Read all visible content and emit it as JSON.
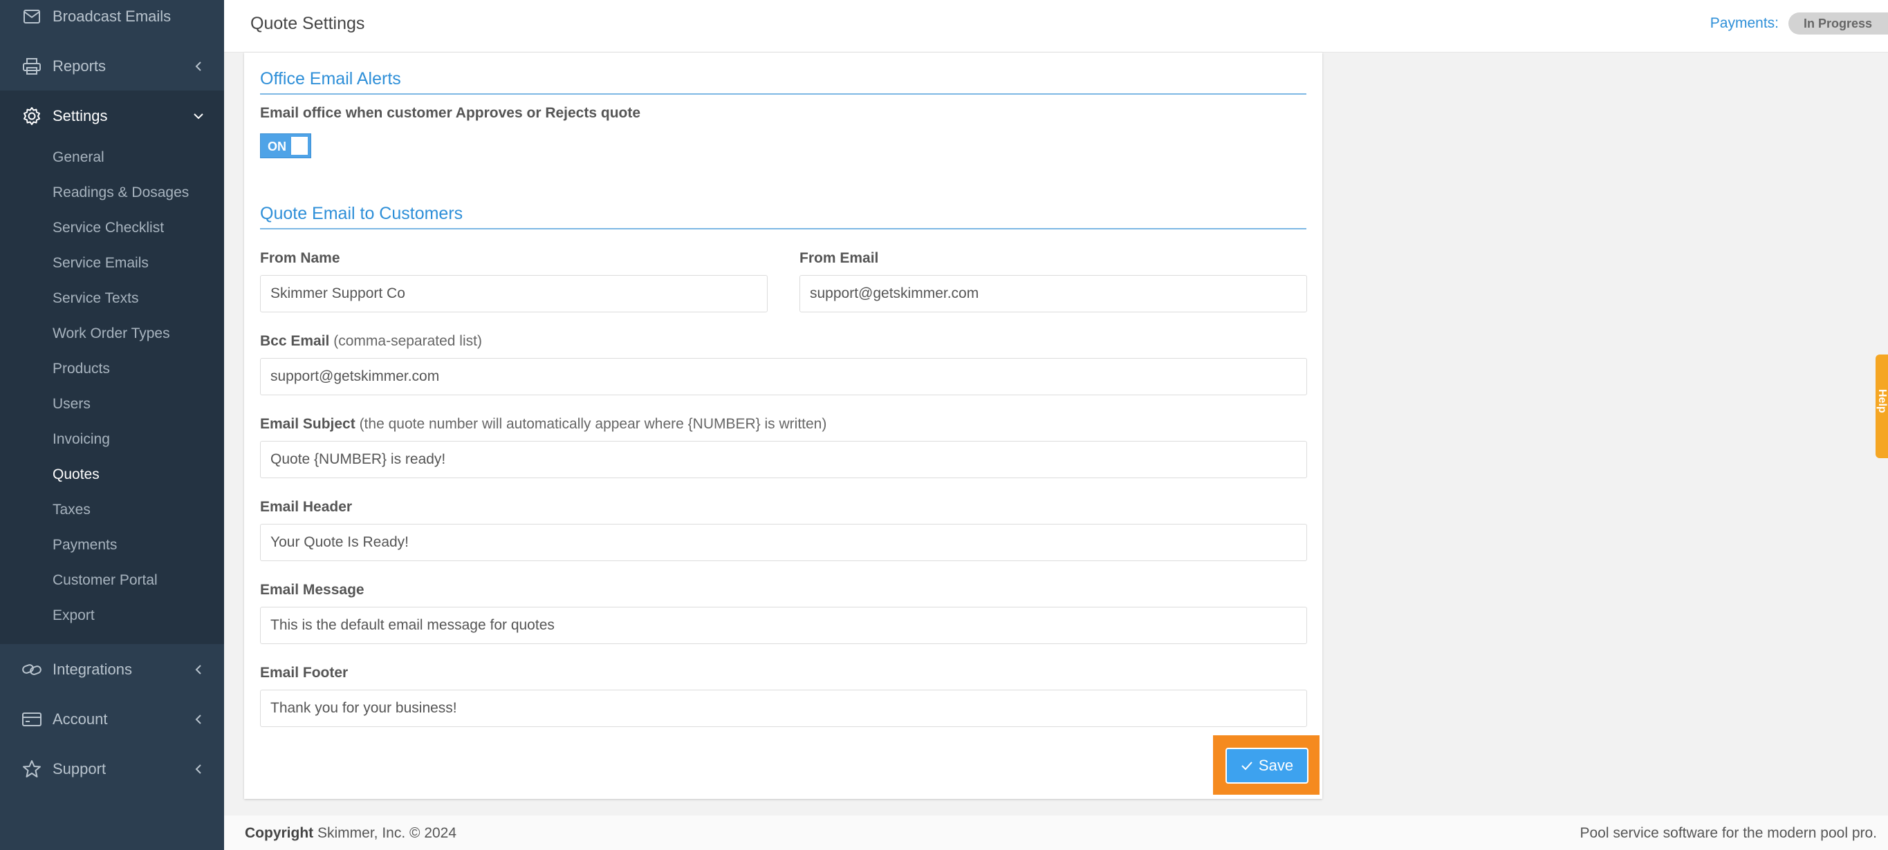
{
  "sidebar": {
    "top_items": [
      {
        "label": "Broadcast Emails",
        "icon": "envelope-icon"
      },
      {
        "label": "Reports",
        "icon": "printer-icon"
      },
      {
        "label": "Settings",
        "icon": "gear-icon"
      }
    ],
    "settings_sub_items": [
      "General",
      "Readings & Dosages",
      "Service Checklist",
      "Service Emails",
      "Service Texts",
      "Work Order Types",
      "Products",
      "Users",
      "Invoicing",
      "Quotes",
      "Taxes",
      "Payments",
      "Customer Portal",
      "Export"
    ],
    "bottom_items": [
      {
        "label": "Integrations",
        "icon": "link-icon"
      },
      {
        "label": "Account",
        "icon": "credit-card-icon"
      },
      {
        "label": "Support",
        "icon": "star-icon"
      }
    ]
  },
  "header": {
    "title": "Quote Settings",
    "payments_label": "Payments:",
    "payments_status": "In Progress"
  },
  "office_alerts": {
    "section_title": "Office Email Alerts",
    "toggle_label": "Email office when customer Approves or Rejects quote",
    "toggle_state": "ON"
  },
  "quote_email": {
    "section_title": "Quote Email to Customers",
    "from_name": {
      "label": "From Name",
      "value": "Skimmer Support Co"
    },
    "from_email": {
      "label": "From Email",
      "value": "support@getskimmer.com"
    },
    "bcc_email": {
      "label": "Bcc Email",
      "hint": "(comma-separated list)",
      "value": "support@getskimmer.com"
    },
    "subject": {
      "label": "Email Subject",
      "hint": "(the quote number will automatically appear where {NUMBER} is written)",
      "value": "Quote {NUMBER} is ready!"
    },
    "header": {
      "label": "Email Header",
      "value": "Your Quote Is Ready!"
    },
    "message": {
      "label": "Email Message",
      "value": "This is the default email message for quotes"
    },
    "footer": {
      "label": "Email Footer",
      "value": "Thank you for your business!"
    }
  },
  "actions": {
    "save_label": "Save"
  },
  "help_tab": {
    "label": "Help"
  },
  "footer": {
    "copyright_bold": "Copyright",
    "copyright_rest": " Skimmer, Inc. © 2024",
    "tagline": "Pool service software for the modern pool pro."
  },
  "colors": {
    "sidebar_bg": "#2c3e50",
    "accent_blue": "#2e8fd8",
    "highlight_orange": "#f58a1f",
    "help_orange": "#f5a623"
  }
}
